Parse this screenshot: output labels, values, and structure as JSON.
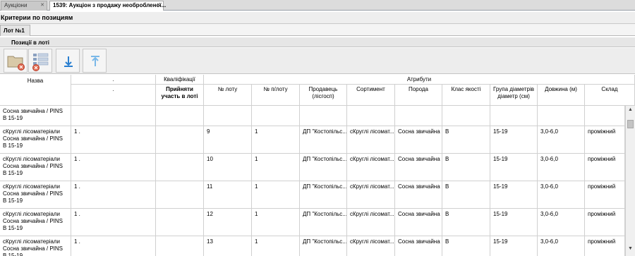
{
  "tabs": [
    {
      "label": "Аукціони",
      "active": false
    },
    {
      "label": "1539: Аукціон з продажу необробленої...",
      "active": true
    }
  ],
  "criteria_title": "Критерии по позициям",
  "lot_tab": "Лот №1",
  "positions_title": "Позиції в лоті",
  "toolbar_icons": [
    "folder-remove-icon",
    "list-remove-icon",
    "move-down-icon",
    "move-up-icon"
  ],
  "header": {
    "name": "Назва",
    "dot_group": ".",
    "qual_group": "Кваліфікації",
    "attr_group": "Атрибути",
    "dot_sub": ".",
    "accepted": "Прийняти участь в лоті",
    "columns": [
      "№ лоту",
      "№ п/лоту",
      "Продавець (лісгосп)",
      "Сортимент",
      "Порода",
      "Клас якості",
      "Група діаметрів діаметр (см)",
      "Довжина (м)",
      "Склад"
    ]
  },
  "rows": [
    {
      "name": "Сосна звичайна / PINS B 15-19",
      "dot": "",
      "accepted": "",
      "cells": [
        "",
        "",
        "",
        "",
        "",
        "",
        "",
        "",
        ""
      ]
    },
    {
      "name": "сКруглі лісоматеріали Сосна звичайна / PINS B 15-19",
      "dot": "1 .",
      "accepted": "",
      "cells": [
        "9",
        "1",
        "ДП \"Костопільс...",
        "сКруглі лісомат...",
        "Сосна звичайна",
        "B",
        "15-19",
        "3,0-6,0",
        "проміжний"
      ]
    },
    {
      "name": "сКруглі лісоматеріали Сосна звичайна / PINS B 15-19",
      "dot": "1 .",
      "accepted": "",
      "cells": [
        "10",
        "1",
        "ДП \"Костопільс...",
        "сКруглі лісомат...",
        "Сосна звичайна",
        "B",
        "15-19",
        "3,0-6,0",
        "проміжний"
      ]
    },
    {
      "name": "сКруглі лісоматеріали Сосна звичайна / PINS B 15-19",
      "dot": "1 .",
      "accepted": "",
      "cells": [
        "11",
        "1",
        "ДП \"Костопільс...",
        "сКруглі лісомат...",
        "Сосна звичайна",
        "B",
        "15-19",
        "3,0-6,0",
        "проміжний"
      ]
    },
    {
      "name": "сКруглі лісоматеріали Сосна звичайна / PINS B 15-19",
      "dot": "1 .",
      "accepted": "",
      "cells": [
        "12",
        "1",
        "ДП \"Костопільс...",
        "сКруглі лісомат...",
        "Сосна звичайна",
        "B",
        "15-19",
        "3,0-6,0",
        "проміжний"
      ]
    },
    {
      "name": "сКруглі лісоматеріали Сосна звичайна / PINS B 15-19",
      "dot": "1 .",
      "accepted": "",
      "cells": [
        "13",
        "1",
        "ДП \"Костопільс...",
        "сКруглі лісомат...",
        "Сосна звичайна",
        "B",
        "15-19",
        "3,0-6,0",
        "проміжний"
      ]
    }
  ]
}
